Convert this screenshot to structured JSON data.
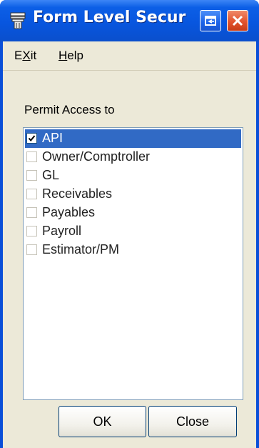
{
  "window": {
    "title": "Form Level Secur",
    "app_icon": "form-icon",
    "restore_icon": "restore-icon",
    "close_icon": "close-icon"
  },
  "menu": {
    "exit_pre": "E",
    "exit_u": "X",
    "exit_post": "it",
    "help_pre": "",
    "help_u": "H",
    "help_post": "elp"
  },
  "permit": {
    "label": "Permit Access to",
    "items": [
      {
        "label": "API",
        "checked": true,
        "selected": true
      },
      {
        "label": "Owner/Comptroller",
        "checked": false,
        "selected": false
      },
      {
        "label": "GL",
        "checked": false,
        "selected": false
      },
      {
        "label": "Receivables",
        "checked": false,
        "selected": false
      },
      {
        "label": "Payables",
        "checked": false,
        "selected": false
      },
      {
        "label": "Payroll",
        "checked": false,
        "selected": false
      },
      {
        "label": "Estimator/PM",
        "checked": false,
        "selected": false
      }
    ]
  },
  "buttons": {
    "ok": "OK",
    "close": "Close"
  },
  "colors": {
    "titlebar": "#0856df",
    "selection": "#316ac5",
    "face": "#ece9d8"
  }
}
